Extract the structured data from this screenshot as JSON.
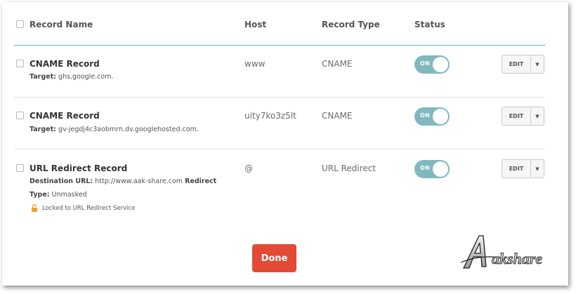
{
  "header": {
    "record_name": "Record Name",
    "host": "Host",
    "record_type": "Record Type",
    "status": "Status"
  },
  "records": [
    {
      "name": "CNAME Record",
      "target_label": "Target:",
      "target_value": "ghs.google.com.",
      "host": "www",
      "type": "CNAME",
      "status": "ON",
      "edit": "EDIT"
    },
    {
      "name": "CNAME Record",
      "target_label": "Target:",
      "target_value": "gv-jegdj4c3aobmrn.dv.googlehosted.com.",
      "host": "uity7ko3z5lt",
      "type": "CNAME",
      "status": "ON",
      "edit": "EDIT"
    },
    {
      "name": "URL Redirect Record",
      "dest_label": "Destination URL:",
      "dest_value": "http://www.aak-share.com",
      "redirect_label": "Redirect",
      "type_label": "Type:",
      "type_value": "Unmasked",
      "lock_text": "Locked to URL Redirect Service",
      "host": "@",
      "type": "URL Redirect",
      "status": "ON",
      "edit": "EDIT"
    }
  ],
  "done_button": "Done",
  "watermark": "Akshare",
  "colors": {
    "toggle_on": "#7fb9bd",
    "header_rule": "#6ab0b8",
    "done": "#e24a35",
    "lock": "#f0a030"
  },
  "icons": {
    "dropdown": "caret-down-icon",
    "lock": "lock-icon"
  }
}
